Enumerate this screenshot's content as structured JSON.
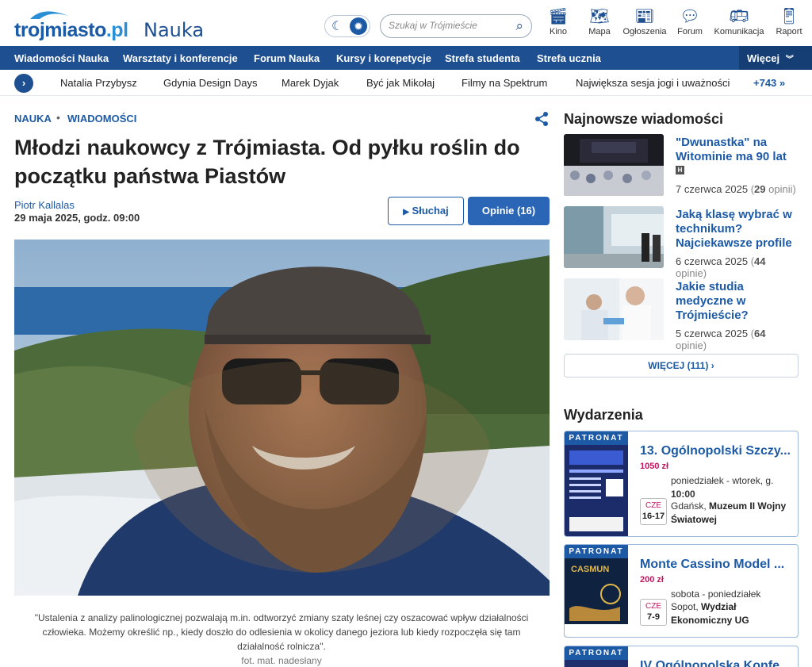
{
  "header": {
    "logo_main": "trojmiasto",
    "logo_pl": ".pl",
    "section": "Nauka",
    "search_placeholder": "Szukaj w Trójmieście",
    "icons": [
      {
        "label": "Kino",
        "icon": "clapperboard-icon"
      },
      {
        "label": "Mapa",
        "icon": "map-icon"
      },
      {
        "label": "Ogłoszenia",
        "icon": "classifieds-icon"
      },
      {
        "label": "Forum",
        "icon": "chat-icon"
      },
      {
        "label": "Komunikacja",
        "icon": "bus-icon"
      },
      {
        "label": "Raport",
        "icon": "phone-report-icon"
      }
    ]
  },
  "nav": {
    "items": [
      "Wiadomości Nauka",
      "Warsztaty i konferencje",
      "Forum Nauka",
      "Kursy i korepetycje",
      "Strefa studenta",
      "Strefa ucznia"
    ],
    "more": "Więcej"
  },
  "trending": {
    "items": [
      "Natalia Przybysz",
      "Gdynia Design Days",
      "Marek Dyjak",
      "Być jak Mikołaj",
      "Filmy na Spektrum",
      "Największa sesja jogi i uważności"
    ],
    "count": "+743 »"
  },
  "article": {
    "crumb1": "NAUKA",
    "crumb2": "WIADOMOŚCI",
    "title": "Młodzi naukowcy z Trójmiasta. Od pyłku roślin do początku państwa Piastów",
    "author": "Piotr Kallalas",
    "date": "29 maja 2025, godz. 09:00",
    "listen_label": "Słuchaj",
    "opinions_label": "Opinie (16)",
    "caption": "\"Ustalenia z analizy palinologicznej pozwalają m.in. odtworzyć zmiany szaty leśnej czy oszacować wpływ działalności człowieka. Możemy określić np., kiedy doszło do odlesienia w okolicy danego jeziora lub kiedy rozpoczęła się tam działalność rolnicza\".",
    "credit": "fot. mat. nadesłany"
  },
  "news": {
    "heading": "Najnowsze wiadomości",
    "items": [
      {
        "title": "\"Dwunastka\" na Witominie ma 90 lat",
        "date": "7 czerwca 2025",
        "opinions": "29",
        "opinions_suffix": "opinii"
      },
      {
        "title": "Jaką klasę wybrać w technikum? Najciekawsze profile",
        "date": "6 czerwca 2025",
        "opinions": "44",
        "opinions_suffix": "opinie"
      },
      {
        "title": "Jakie studia medyczne w Trójmieście?",
        "date": "5 czerwca 2025",
        "opinions": "64",
        "opinions_suffix": "opinie"
      }
    ],
    "badge": "H",
    "more_label": "WIĘCEJ",
    "more_count": "(111)"
  },
  "events": {
    "heading": "Wydarzenia",
    "badge": "PATRONAT",
    "items": [
      {
        "title": "13. Ogólnopolski Szczy...",
        "price": "1050 zł",
        "when": "poniedziałek - wtorek, g.",
        "time": "10:00",
        "day_label": "CZE",
        "days": "16-17",
        "city": "Gdańsk,",
        "venue": "Muzeum II Wojny Światowej"
      },
      {
        "title": "Monte Cassino Model ...",
        "price": "200 zł",
        "when": "sobota - poniedziałek",
        "time": "",
        "day_label": "CZE",
        "days": "7-9",
        "city": "Sopot,",
        "venue": "Wydział Ekonomiczny UG"
      },
      {
        "title": "IV Ogólnopolska Konfe..."
      }
    ]
  },
  "colors": {
    "brand": "#1d4f91",
    "link": "#1d5aa6",
    "price": "#c0185f"
  }
}
